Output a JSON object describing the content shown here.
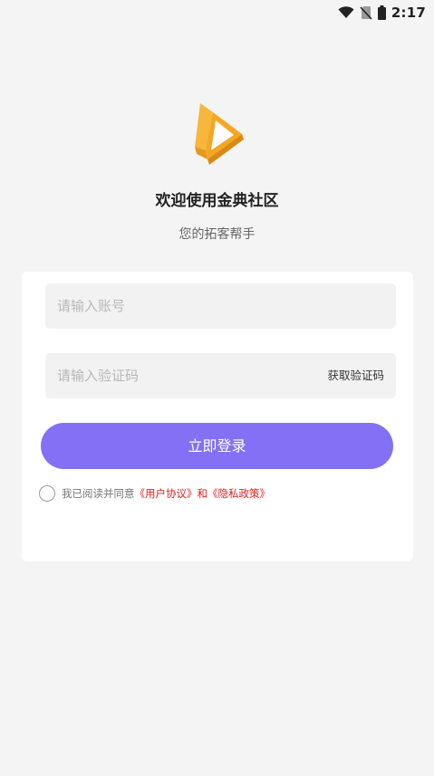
{
  "status_bar": {
    "time": "2:17",
    "icons": [
      "wifi-icon",
      "no-sim-icon",
      "battery-icon"
    ]
  },
  "header": {
    "title": "欢迎使用金典社区",
    "subtitle": "您的拓客帮手"
  },
  "form": {
    "account_placeholder": "请输入账号",
    "account_value": "",
    "code_placeholder": "请输入验证码",
    "code_value": "",
    "get_code_label": "获取验证码",
    "login_label": "立即登录"
  },
  "agreement": {
    "prefix": "我已阅读并同意",
    "user_agreement": "《用户协议》",
    "and": "和",
    "privacy_policy": "《隐私政策》",
    "checked": false
  },
  "colors": {
    "primary": "#8470f5",
    "link": "#e02020",
    "logo_orange": "#f5a623",
    "background": "#f4f4f4"
  }
}
